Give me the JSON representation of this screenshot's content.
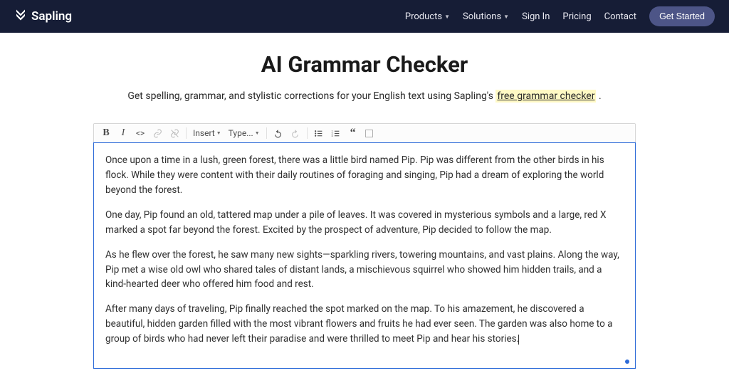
{
  "brand": "Sapling",
  "nav": {
    "products": "Products",
    "solutions": "Solutions",
    "signin": "Sign In",
    "pricing": "Pricing",
    "contact": "Contact",
    "get_started": "Get Started"
  },
  "page": {
    "title": "AI Grammar Checker",
    "subtitle_prefix": "Get spelling, grammar, and stylistic corrections for your English text using Sapling's ",
    "subtitle_link": "free grammar checker",
    "subtitle_suffix": " ."
  },
  "toolbar": {
    "insert_label": "Insert",
    "type_label": "Type..."
  },
  "editor": {
    "p1": "Once upon a time in a lush, green forest, there was a little bird named Pip. Pip was different from the other birds in his flock. While they were content with their daily routines of foraging and singing, Pip had a dream of exploring the world beyond the forest.",
    "p2": "One day, Pip found an old, tattered map under a pile of leaves. It was covered in mysterious symbols and a large, red X marked a spot far beyond the forest. Excited by the prospect of adventure, Pip decided to follow the map.",
    "p3": "As he flew over the forest, he saw many new sights—sparkling rivers, towering mountains, and vast plains. Along the way, Pip met a wise old owl who shared tales of distant lands, a mischievous squirrel who showed him hidden trails, and a kind-hearted deer who offered him food and rest.",
    "p4": "After many days of traveling, Pip finally reached the spot marked on the map. To his amazement, he discovered a beautiful, hidden garden filled with the most vibrant flowers and fruits he had ever seen. The garden was also home to a group of birds who had never left their paradise and were thrilled to meet Pip and hear his stories."
  }
}
